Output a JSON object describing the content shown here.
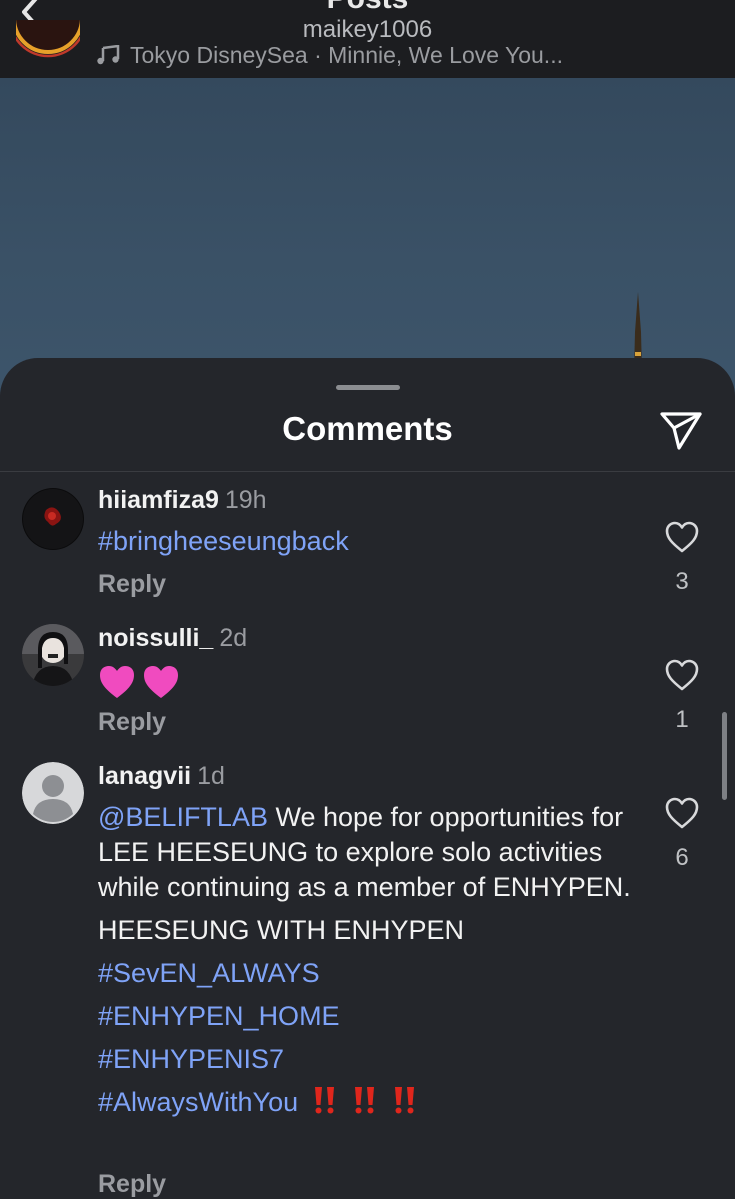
{
  "header": {
    "title": "Posts",
    "username": "maikey1006",
    "music": "Tokyo DisneySea · Minnie, We Love You..."
  },
  "comments_sheet": {
    "title": "Comments",
    "comments": [
      {
        "username": "hiiamfiza9",
        "time": "19h",
        "text": "#bringheeseungback",
        "reply_label": "Reply",
        "likes": "3"
      },
      {
        "username": "noissulli_",
        "time": "2d",
        "text": "💗💗",
        "reply_label": "Reply",
        "likes": "1"
      },
      {
        "username": "lanagvii",
        "time": "1d",
        "mention": "@BELIFTLAB",
        "text": " We hope for opportunities for LEE HEESEUNG to explore solo activities while continuing as a member of ENHYPEN.",
        "line2": "HEESEUNG WITH ENHYPEN",
        "hashtags": [
          "#SevEN_ALWAYS",
          "#ENHYPEN_HOME",
          "#ENHYPENIS7",
          "#AlwaysWithYou"
        ],
        "emoji": "‼️‼️‼️",
        "reply_label": "Reply",
        "likes": "6"
      }
    ]
  },
  "colors": {
    "background": "#24262b",
    "link": "#7fa3f7",
    "secondary_text": "#9a9ca1",
    "heart_pink": "#f04bbf",
    "bang_red": "#e0261c"
  },
  "icons": [
    "back-chevron-icon",
    "music-note-icon",
    "share-send-icon",
    "heart-outline-icon",
    "pink-heart-icon",
    "double-exclamation-icon",
    "default-avatar-icon"
  ]
}
